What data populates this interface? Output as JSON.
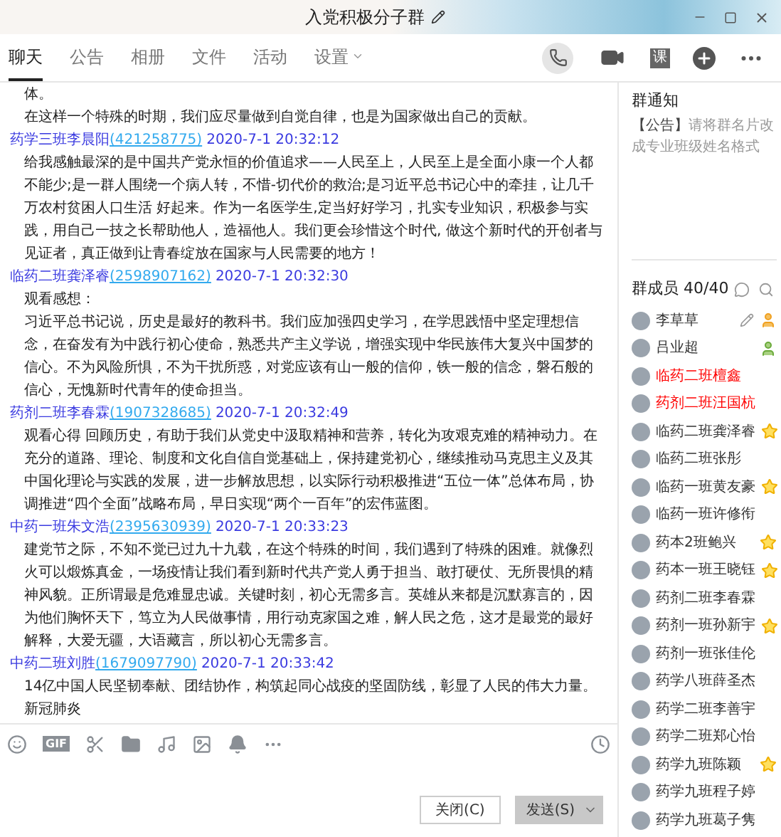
{
  "window": {
    "title": "入党积极分子群"
  },
  "tabs": [
    {
      "label": "聊天",
      "selected": true
    },
    {
      "label": "公告",
      "selected": false
    },
    {
      "label": "相册",
      "selected": false
    },
    {
      "label": "文件",
      "selected": false
    },
    {
      "label": "活动",
      "selected": false
    },
    {
      "label": "设置",
      "selected": false,
      "dropdown": true
    }
  ],
  "header_actions": [
    {
      "kind": "phone"
    },
    {
      "kind": "video"
    },
    {
      "kind": "text",
      "label": "课"
    },
    {
      "kind": "plus"
    },
    {
      "kind": "more"
    }
  ],
  "messages": [
    {
      "paragraphs": [
        "体。",
        "在这样一个特殊的时期，我们应尽量做到自觉自律，也是为国家做出自己的贡献。"
      ]
    },
    {
      "sender": "药学三班李晨阳",
      "qq": "(421258775)",
      "time": "2020-7-1 20:32:12",
      "paragraphs": [
        "给我感触最深的是中国共产党永恒的价值追求——人民至上，人民至上是全面小康一个人都不能少;是一群人围绕一个病人转，不惜-切代价的救治;是习近平总书记心中的牵挂，让几千万农村贫困人口生活 好起来。作为一名医学生,定当好好学习，扎实专业知识，积极参与实践，用自己一技之长帮助他人，造福他人。我们更会珍惜这个时代, 做这个新时代的开创者与见证者，真正做到让青春绽放在国家与人民需要的地方！"
      ]
    },
    {
      "sender": "临药二班龚泽睿",
      "qq": "(2598907162)",
      "time": "2020-7-1 20:32:30",
      "paragraphs": [
        "观看感想：",
        "习近平总书记说，历史是最好的教科书。我们应加强四史学习，在学思践悟中坚定理想信念，在奋发有为中践行初心使命，熟悉共产主义学说，增强实现中华民族伟大复兴中国梦的信心。不为风险所惧，不为干扰所惑，对党应该有山一般的信仰，铁一般的信念，磐石般的信心，无愧新时代青年的使命担当。"
      ]
    },
    {
      "sender": "药剂二班李春霖",
      "qq": "(1907328685)",
      "time": "2020-7-1 20:32:49",
      "paragraphs": [
        "观看心得 回顾历史，有助于我们从党史中汲取精神和营养，转化为攻艰克难的精神动力。在充分的道路、理论、制度和文化自信自觉基础上，保持建党初心，继续推动马克思主义及其中国化理论与实践的发展，进一步解放思想，以实际行动积极推进“五位一体”总体布局，协调推进“四个全面”战略布局，早日实现“两个一百年”的宏伟蓝图。"
      ]
    },
    {
      "sender": "中药一班朱文浩",
      "qq": "(2395630939)",
      "time": "2020-7-1 20:33:23",
      "paragraphs": [
        "建党节之际，不知不觉已过九十九载，在这个特殊的时间，我们遇到了特殊的困难。就像烈火可以煅炼真金，一场疫情让我们看到新时代共产党人勇于担当、敢打硬仗、无所畏惧的精神风貌。正所谓最是危难显忠诚。关键时刻，初心无需多言。英雄从来都是沉默寡言的，因为他们胸怀天下，笃立为人民做事情，用行动克家国之难，解人民之危，这才是最党的最好解释，大爱无疆，大语藏言，所以初心无需多言。"
      ]
    },
    {
      "sender": "中药二班刘胜",
      "qq": "(1679097790)",
      "time": "2020-7-1 20:33:42",
      "paragraphs": [
        "14亿中国人民坚韧奉献、团结协作，构筑起同心战疫的坚固防线，彰显了人民的伟大力量。新冠肺炎"
      ]
    }
  ],
  "toolbar": [
    {
      "kind": "smiley"
    },
    {
      "kind": "gif",
      "label": "GIF"
    },
    {
      "kind": "scissors"
    },
    {
      "kind": "folder"
    },
    {
      "kind": "music"
    },
    {
      "kind": "image"
    },
    {
      "kind": "bell"
    },
    {
      "kind": "more"
    }
  ],
  "buttons": [
    {
      "label": "关闭(C)",
      "primary": false
    },
    {
      "label": "发送(S)",
      "primary": true
    }
  ],
  "notice": {
    "title": "群通知",
    "tag": "【公告】",
    "text": "请将群名片改成专业班级姓名格式"
  },
  "members_header": "群成员 40/40",
  "members": [
    {
      "name": "李草草",
      "color": "#333333",
      "kind": "owner",
      "editable": true
    },
    {
      "name": "吕业超",
      "color": "#333333",
      "kind": "admin",
      "editable": false
    },
    {
      "name": "临药二班檀鑫",
      "color": "#ff0000",
      "kind": "plain",
      "editable": false
    },
    {
      "name": "药剂二班汪国杭",
      "color": "#ff0000",
      "kind": "plain",
      "editable": false
    },
    {
      "name": "临药二班龚泽睿",
      "color": "#333333",
      "kind": "star",
      "editable": false
    },
    {
      "name": "临药二班张彤",
      "color": "#333333",
      "kind": "plain",
      "editable": false
    },
    {
      "name": "临药一班黄友豪",
      "color": "#333333",
      "kind": "star",
      "editable": false
    },
    {
      "name": "临药一班许修衔",
      "color": "#333333",
      "kind": "plain",
      "editable": false
    },
    {
      "name": "药本2班鲍兴",
      "color": "#333333",
      "kind": "star",
      "editable": false
    },
    {
      "name": "药本一班王晓钰",
      "color": "#333333",
      "kind": "star",
      "editable": false
    },
    {
      "name": "药剂二班李春霖",
      "color": "#333333",
      "kind": "plain",
      "editable": false
    },
    {
      "name": "药剂一班孙新宇",
      "color": "#333333",
      "kind": "star",
      "editable": false
    },
    {
      "name": "药剂一班张佳伦",
      "color": "#333333",
      "kind": "plain",
      "editable": false
    },
    {
      "name": "药学八班薛圣杰",
      "color": "#333333",
      "kind": "plain",
      "editable": false
    },
    {
      "name": "药学二班李善宇",
      "color": "#333333",
      "kind": "plain",
      "editable": false
    },
    {
      "name": "药学二班郑心怡",
      "color": "#333333",
      "kind": "plain",
      "editable": false
    },
    {
      "name": "药学九班陈颖",
      "color": "#333333",
      "kind": "star",
      "editable": false
    },
    {
      "name": "药学九班程子婷",
      "color": "#333333",
      "kind": "plain",
      "editable": false
    },
    {
      "name": "药学九班葛子隽",
      "color": "#333333",
      "kind": "plain",
      "editable": false
    }
  ]
}
